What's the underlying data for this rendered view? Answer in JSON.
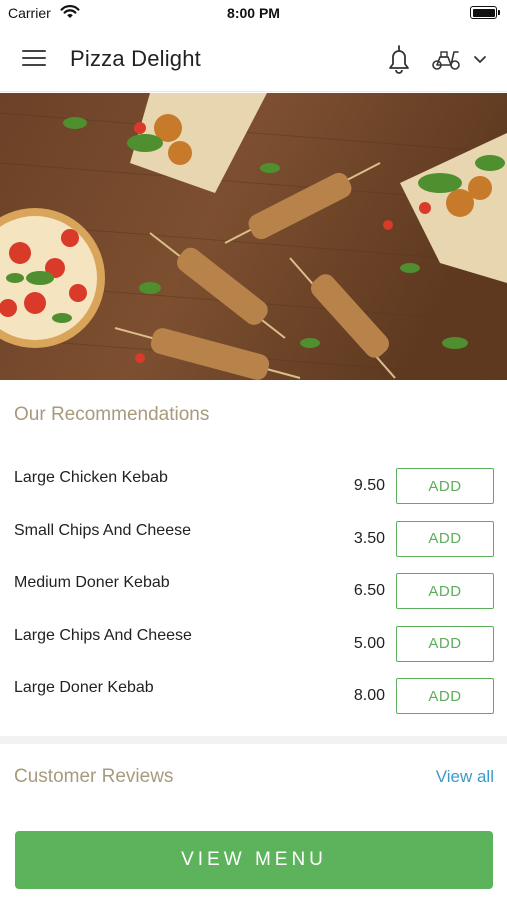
{
  "status_bar": {
    "carrier": "Carrier",
    "time": "8:00 PM"
  },
  "header": {
    "title": "Pizza Delight",
    "icons": [
      "hamburger-menu-icon",
      "bell-icon",
      "scooter-icon",
      "chevron-down-icon"
    ]
  },
  "hero": {
    "icon": "food-photo"
  },
  "recommendations": {
    "title": "Our Recommendations",
    "items": [
      {
        "name": "Large Chicken Kebab",
        "price": "9.50",
        "button": "ADD"
      },
      {
        "name": "Small Chips And Cheese",
        "price": "3.50",
        "button": "ADD"
      },
      {
        "name": "Medium Doner Kebab",
        "price": "6.50",
        "button": "ADD"
      },
      {
        "name": "Large Chips And Cheese",
        "price": "5.00",
        "button": "ADD"
      },
      {
        "name": "Large Doner Kebab",
        "price": "8.00",
        "button": "ADD"
      }
    ]
  },
  "reviews": {
    "title": "Customer Reviews",
    "view_all": "View all"
  },
  "footer": {
    "view_menu": "VIEW MENU"
  },
  "colors": {
    "accent_green": "#5cb35c",
    "section_title": "#a89a7d",
    "link_blue": "#3a9bc8"
  }
}
